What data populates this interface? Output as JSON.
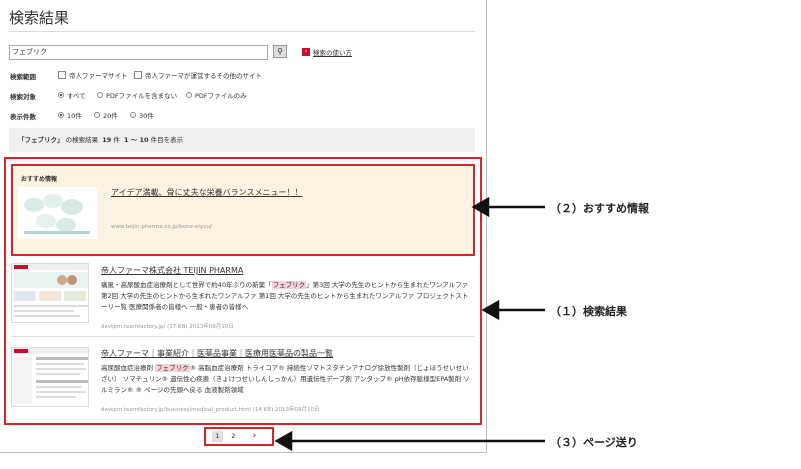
{
  "page": {
    "title": "検索結果"
  },
  "search": {
    "value": "フェブリク",
    "button_icon": "⚲",
    "help_arrow": "›",
    "help_link": "検索の使い方"
  },
  "options": {
    "scope": {
      "label": "検索範囲",
      "items": [
        "帝人ファーマサイト",
        "帝人ファーマが運営するその他のサイト"
      ]
    },
    "target": {
      "label": "検索対象",
      "items": [
        "すべて",
        "PDFファイルを含まない",
        "PDFファイルのみ"
      ],
      "selected": 0
    },
    "count": {
      "label": "表示件数",
      "items": [
        "10件",
        "20件",
        "30件"
      ],
      "selected": 0
    }
  },
  "summary": {
    "query": "「フェブリク」",
    "text1": "の検索結果",
    "total": "19",
    "unit1": "件",
    "range": "1 ～ 10",
    "text2": "件目を表示"
  },
  "recommend": {
    "heading": "おすすめ情報",
    "link": "アイデア満載、骨に丈夫な栄養バランスメニュー！！",
    "url": "www.teijin-pharma.co.jp/bone-eiyou/"
  },
  "results": [
    {
      "title": "帝人ファーマ株式会社 TEIJIN PHARMA",
      "body_pre": "痛風・高尿酸血症治療剤として世界で約40年ぶりの新薬「",
      "highlight": "フェブリク",
      "body_post": "」第3回 大学の先生のヒントから生まれたワンアルファ 第2回 大学の先生のヒントから生まれたワンアルファ 第1回 大学の先生のヒントから生まれたワンアルファ プロジェクトストーリー覧 医療関係者の皆様へ 一般・患者の皆様へ",
      "meta": "devtpm.teamfactory.jp/ (17 KB) 2013年09月10日"
    },
    {
      "title": "帝人ファーマ｜事業紹介｜医薬品事業｜医療用医薬品の製品一覧",
      "body_pre": "高尿酸血症治療剤 ",
      "highlight": "フェブリク",
      "body_post": "® 高脂血症治療剤 トライコア® 持続性ソマトスタチンアナログ徐放性製剤（じょほうせいせいざい） ソマチュリン® 遺伝性心疾患（きょけつせいしんしっかん）用遺伝性デープ剤 アンタップ® pH依存脈様型EPA製剤 ソルミラン® ® ページの先頭へ戻る 血液製剤領域",
      "meta": "devtpm.teamfactory.jp/business/medical_product.html (14 KB) 2013年09月10日"
    }
  ],
  "pagination": {
    "pages": [
      "1",
      "2"
    ],
    "next": "›",
    "current": 0
  },
  "callouts": {
    "recommend": "（２）おすすめ情報",
    "results": "（１）検索結果",
    "paging": "（３）ページ送り"
  },
  "colors": {
    "accent_red": "#d9232a",
    "recommend_bg": "#fdf3e3",
    "highlight_bg": "#f6d0d4"
  }
}
